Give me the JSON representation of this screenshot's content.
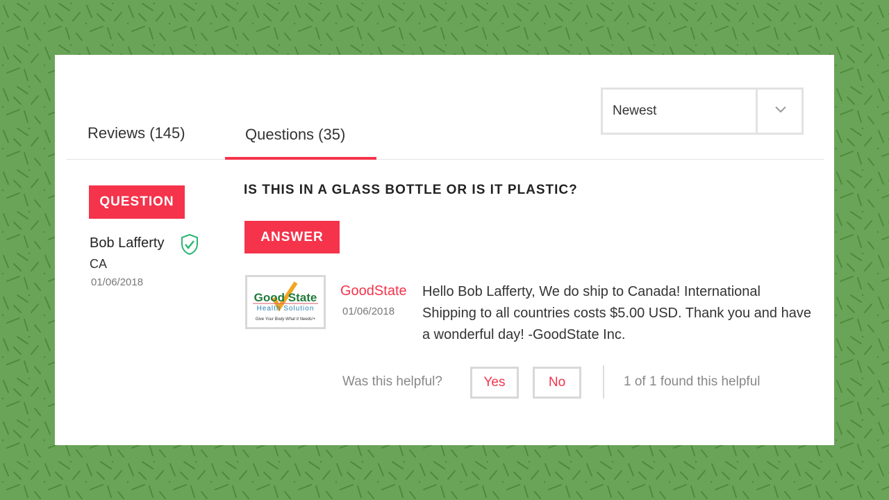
{
  "colors": {
    "accent": "#f5334b",
    "background": "#6aa458",
    "verified": "#2bb673"
  },
  "tabs": [
    {
      "label": "Reviews (145)",
      "active": false
    },
    {
      "label": "Questions (35)",
      "active": true
    }
  ],
  "sort": {
    "selected": "Newest",
    "icon": "chevron-down-icon"
  },
  "question": {
    "badge": "QUESTION",
    "author": "Bob Lafferty",
    "verified_icon": "shield-check-icon",
    "location": "CA",
    "date": "01/06/2018",
    "title": "IS THIS IN A GLASS BOTTLE OR IS IT PLASTIC?"
  },
  "answer": {
    "badge": "ANSWER",
    "logo": {
      "line1": "Good State",
      "line2": "Health Solution",
      "tagline": "Give Your Body What It Needs!+"
    },
    "author": "GoodState",
    "date": "01/06/2018",
    "text": "Hello Bob Lafferty, We do ship to Canada! International Shipping to all countries costs $5.00 USD. Thank you and have a wonderful day! -GoodState Inc."
  },
  "helpful": {
    "prompt": "Was this helpful?",
    "yes": "Yes",
    "no": "No",
    "count": "1 of 1 found this helpful"
  }
}
